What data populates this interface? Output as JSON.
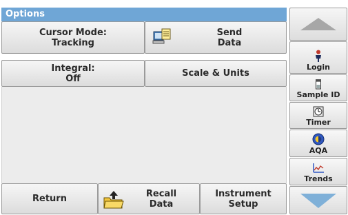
{
  "header": {
    "title": "Options"
  },
  "options": {
    "cursor_mode": "Cursor Mode:\nTracking",
    "send_data": "Send\nData",
    "integral": "Integral:\nOff",
    "scale_units": "Scale & Units"
  },
  "footer": {
    "return": "Return",
    "recall_data": "Recall\nData",
    "instrument_setup": "Instrument\nSetup"
  },
  "sidebar": {
    "items": [
      {
        "label": "Login",
        "icon": "person-icon"
      },
      {
        "label": "Sample ID",
        "icon": "vial-icon"
      },
      {
        "label": "Timer",
        "icon": "timer-icon"
      },
      {
        "label": "AQA",
        "icon": "aqa-icon"
      },
      {
        "label": "Trends",
        "icon": "trends-icon"
      }
    ]
  },
  "colors": {
    "title_bg": "#6fa6d6",
    "arrow": "#7fb0d8"
  }
}
